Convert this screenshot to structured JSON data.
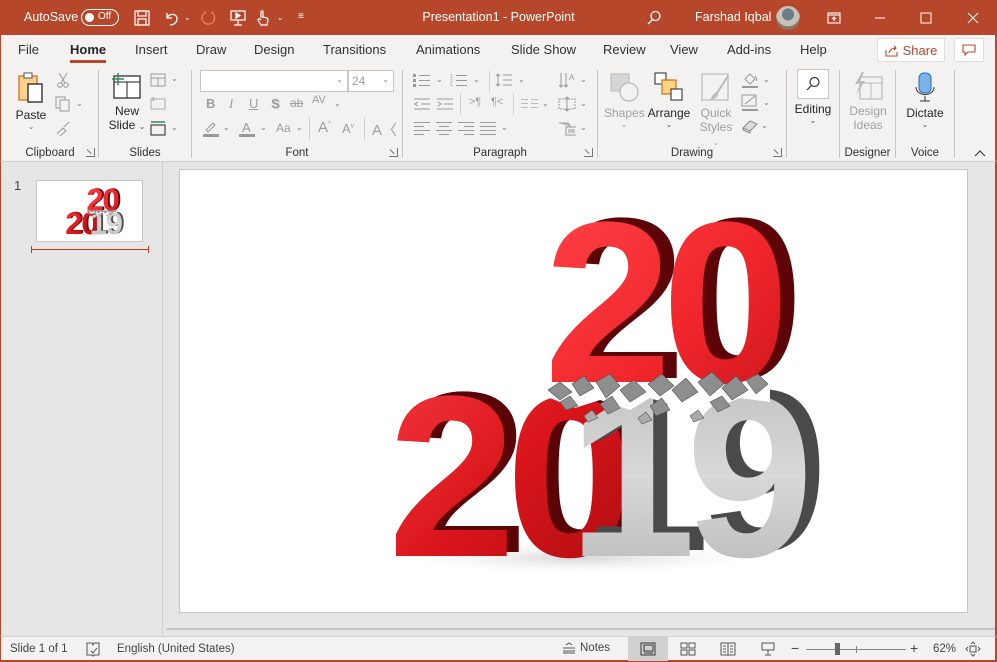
{
  "titlebar": {
    "autosave_label": "AutoSave",
    "autosave_state": "Off",
    "document_title": "Presentation1",
    "separator": "-",
    "app_name": "PowerPoint",
    "user_name": "Farshad Iqbal"
  },
  "tabs": [
    {
      "label": "File",
      "active": false
    },
    {
      "label": "Home",
      "active": true
    },
    {
      "label": "Insert",
      "active": false
    },
    {
      "label": "Draw",
      "active": false
    },
    {
      "label": "Design",
      "active": false
    },
    {
      "label": "Transitions",
      "active": false
    },
    {
      "label": "Animations",
      "active": false
    },
    {
      "label": "Slide Show",
      "active": false
    },
    {
      "label": "Review",
      "active": false
    },
    {
      "label": "View",
      "active": false
    },
    {
      "label": "Add-ins",
      "active": false
    },
    {
      "label": "Help",
      "active": false
    }
  ],
  "share": {
    "label": "Share"
  },
  "ribbon": {
    "clipboard": {
      "label": "Clipboard",
      "paste": "Paste"
    },
    "slides": {
      "label": "Slides",
      "new_slide_line1": "New",
      "new_slide_line2": "Slide"
    },
    "font": {
      "label": "Font",
      "font_name": "",
      "font_size": "24",
      "change_case": "Aa"
    },
    "paragraph": {
      "label": "Paragraph"
    },
    "drawing": {
      "label": "Drawing",
      "shapes": "Shapes",
      "arrange": "Arrange",
      "quick_styles_line1": "Quick",
      "quick_styles_line2": "Styles"
    },
    "editing": {
      "label": "Editing"
    },
    "designer": {
      "label": "Designer",
      "design_ideas_line1": "Design",
      "design_ideas_line2": "Ideas"
    },
    "voice": {
      "label": "Voice",
      "dictate": "Dictate"
    }
  },
  "slides_pane": {
    "slides": [
      {
        "number": "1"
      }
    ]
  },
  "slide": {
    "image_description": "3D red and silver numbers 2019 shattering into 2020",
    "top_numbers": "20",
    "bottom_left_numbers": "20",
    "bottom_right_numbers": "19",
    "colors": {
      "red": "#d01418",
      "red_bright": "#f0262c",
      "red_dark": "#5a0406",
      "silver": "#cfcfcf",
      "silver_dark": "#4a4a4a"
    }
  },
  "statusbar": {
    "slide_indicator": "Slide 1 of 1",
    "language": "English (United States)",
    "notes_label": "Notes",
    "zoom_level": "62%",
    "zoom_fraction": 0.3
  },
  "theme": {
    "accent": "#b7472a",
    "ribbon_bg": "#f3f2f1",
    "workspace_bg": "#e6e6e6"
  }
}
